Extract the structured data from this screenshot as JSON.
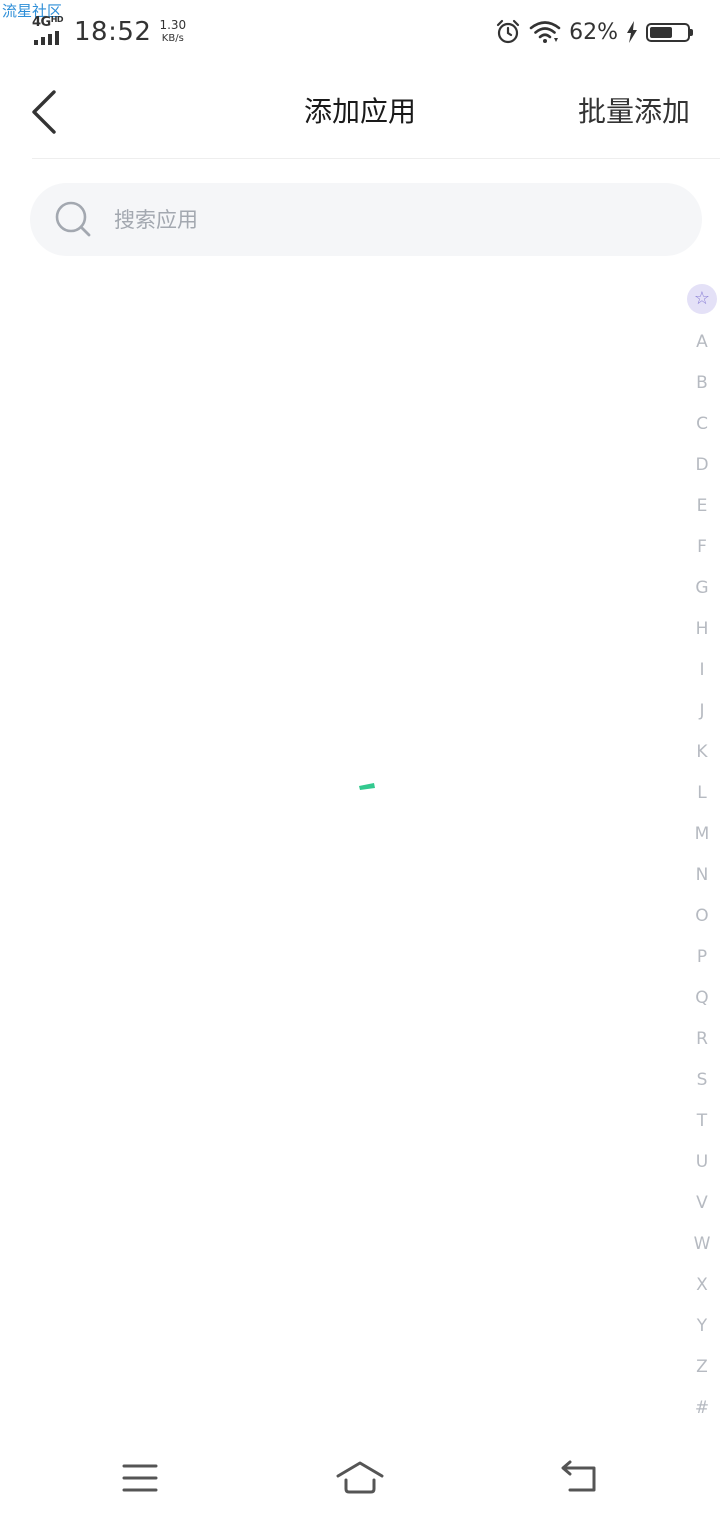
{
  "watermark": "流星社区",
  "status_bar": {
    "network_type": "4G",
    "network_badge": "HD",
    "time": "18:52",
    "speed_value": "1.30",
    "speed_unit": "KB/s",
    "battery_percent": "62%",
    "battery_level": 0.62,
    "icons": [
      "signal-icon",
      "alarm-icon",
      "wifi-icon",
      "charging-icon",
      "battery-icon"
    ]
  },
  "header": {
    "title": "添加应用",
    "action_label": "批量添加",
    "back_icon": "chevron-left-icon"
  },
  "search": {
    "placeholder": "搜索应用",
    "value": "",
    "icon": "search-icon"
  },
  "index_bar": {
    "favorite_symbol": "☆",
    "letters": [
      "A",
      "B",
      "C",
      "D",
      "E",
      "F",
      "G",
      "H",
      "I",
      "J",
      "K",
      "L",
      "M",
      "N",
      "O",
      "P",
      "Q",
      "R",
      "S",
      "T",
      "U",
      "V",
      "W",
      "X",
      "Y",
      "Z",
      "#"
    ]
  },
  "loading": {
    "icon": "loading-spinner-icon",
    "color": "#33c98f"
  },
  "nav_bar": {
    "icons": [
      "menu-icon",
      "home-icon",
      "back-icon"
    ]
  }
}
